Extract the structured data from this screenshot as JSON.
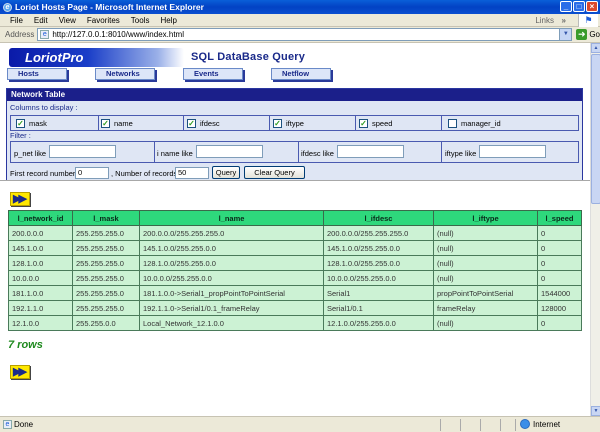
{
  "window": {
    "title": "Loriot Hosts Page - Microsoft Internet Explorer"
  },
  "menu": {
    "items": [
      "File",
      "Edit",
      "View",
      "Favorites",
      "Tools",
      "Help"
    ],
    "links": "Links"
  },
  "address": {
    "label": "Address",
    "url": "http://127.0.0.1:8010/www/index.html",
    "go": "Go"
  },
  "page": {
    "logo": "LoriotPro",
    "title": "SQL DataBase Query"
  },
  "nav": {
    "tabs": [
      "Hosts",
      "Networks",
      "Events",
      "Netflow"
    ]
  },
  "panel": {
    "title": "Network Table",
    "columns_label": "Columns to display :",
    "columns": [
      {
        "label": "mask",
        "checked": true
      },
      {
        "label": "name",
        "checked": true
      },
      {
        "label": "ifdesc",
        "checked": true
      },
      {
        "label": "iftype",
        "checked": true
      },
      {
        "label": "speed",
        "checked": true
      },
      {
        "label": "manager_id",
        "checked": false
      }
    ],
    "filter_label": "Filter :",
    "filters": [
      "p_net like",
      "i name like",
      "ifdesc like",
      "iftype like"
    ],
    "first_record_label": "First record number",
    "first_record_value": "0",
    "num_records_label": ", Number of records",
    "num_records_value": "50",
    "query_button": "Query",
    "clear_button": "Clear Query"
  },
  "results": {
    "columns": [
      "l_network_id",
      "l_mask",
      "l_name",
      "l_ifdesc",
      "l_iftype",
      "l_speed"
    ],
    "rows": [
      [
        "200.0.0.0",
        "255.255.255.0",
        "200.0.0.0/255.255.255.0",
        "200.0.0.0/255.255.255.0",
        "(null)",
        "0"
      ],
      [
        "145.1.0.0",
        "255.255.255.0",
        "145.1.0.0/255.255.0.0",
        "145.1.0.0/255.255.0.0",
        "(null)",
        "0"
      ],
      [
        "128.1.0.0",
        "255.255.255.0",
        "128.1.0.0/255.255.0.0",
        "128.1.0.0/255.255.0.0",
        "(null)",
        "0"
      ],
      [
        "10.0.0.0",
        "255.255.255.0",
        "10.0.0.0/255.255.0.0",
        "10.0.0.0/255.255.0.0",
        "(null)",
        "0"
      ],
      [
        "181.1.0.0",
        "255.255.255.0",
        "181.1.0.0->Serial1_propPointToPointSerial",
        "Serial1",
        "propPointToPointSerial",
        "1544000"
      ],
      [
        "192.1.1.0",
        "255.255.255.0",
        "192.1.1.0->Serial1/0.1_frameRelay",
        "Serial1/0.1",
        "frameRelay",
        "128000"
      ],
      [
        "12.1.0.0",
        "255.255.0.0",
        "Local_Network_12.1.0.0",
        "12.1.0.0/255.255.0.0",
        "(null)",
        "0"
      ]
    ],
    "count_text": "7 rows"
  },
  "status": {
    "text": "Done",
    "zone": "Internet"
  }
}
